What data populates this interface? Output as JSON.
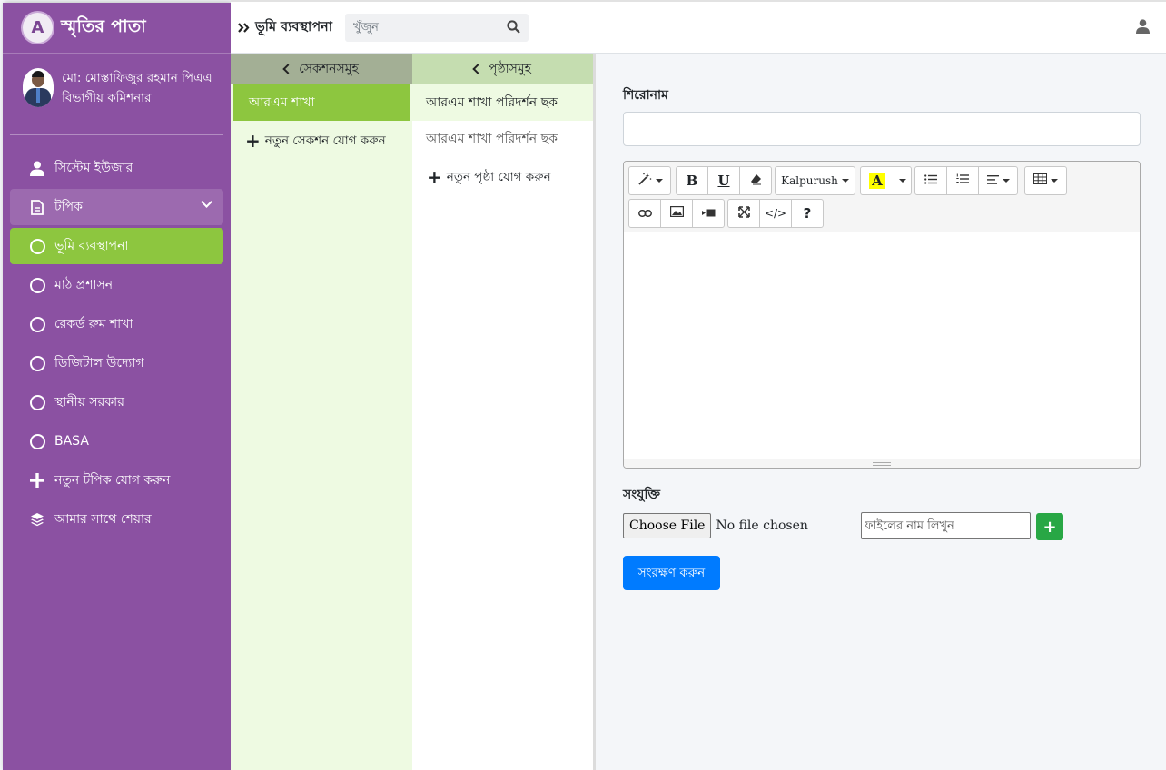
{
  "brand": {
    "logo_letter": "A",
    "title": "স্মৃতির পাতা"
  },
  "user": {
    "name": "মো: মোস্তাফিজুর রহমান পিএএ",
    "role": "বিভাগীয় কমিশনার"
  },
  "sidebar": {
    "items": [
      {
        "label": "সিস্টেম ইউজার",
        "icon": "user-icon"
      },
      {
        "label": "টপিক",
        "icon": "file-icon"
      },
      {
        "label": "ভূমি ব্যবস্থাপনা",
        "icon": "circle-icon"
      },
      {
        "label": "মাঠ প্রশাসন",
        "icon": "circle-icon"
      },
      {
        "label": "রেকর্ড রুম শাখা",
        "icon": "circle-icon"
      },
      {
        "label": "ডিজিটাল উদ্যোগ",
        "icon": "circle-icon"
      },
      {
        "label": "স্থানীয় সরকার",
        "icon": "circle-icon"
      },
      {
        "label": "BASA",
        "icon": "circle-icon"
      },
      {
        "label": "নতুন টপিক যোগ করুন",
        "icon": "plus-icon"
      },
      {
        "label": "আমার সাথে শেয়ার",
        "icon": "layers-icon"
      }
    ]
  },
  "header": {
    "breadcrumb": "ভূমি ব্যবস্থাপনা",
    "search_placeholder": "খুঁজুন"
  },
  "sections": {
    "header": "সেকশনসমুহ",
    "items": [
      "আরএম শাখা"
    ],
    "add_label": "নতুন সেকশন যোগ করুন"
  },
  "pages": {
    "header": "পৃষ্ঠাসমুহ",
    "items": [
      "আরএম শাখা পরিদর্শন ছক",
      "আরএম শাখা পরিদর্শন ছক"
    ],
    "add_label": "নতুন পৃষ্ঠা যোগ করুন"
  },
  "editor": {
    "title_label": "শিরোনাম",
    "title_value": "",
    "toolbar": {
      "bold": "B",
      "underline": "U",
      "font_name": "Kalpurush",
      "color_letter": "A",
      "highlight_color": "#ffff00",
      "help": "?",
      "code": "</>"
    },
    "attachment_label": "সংযুক্তি",
    "choose_file": "Choose File",
    "no_file": "No file chosen",
    "filename_placeholder": "ফাইলের নাম লিখুন",
    "add_file": "+",
    "save_label": "সংরক্ষণ করুন"
  },
  "colors": {
    "sidebar": "#8b51a2",
    "active": "#8dc63f",
    "primary": "#007bff",
    "success": "#28a745"
  }
}
